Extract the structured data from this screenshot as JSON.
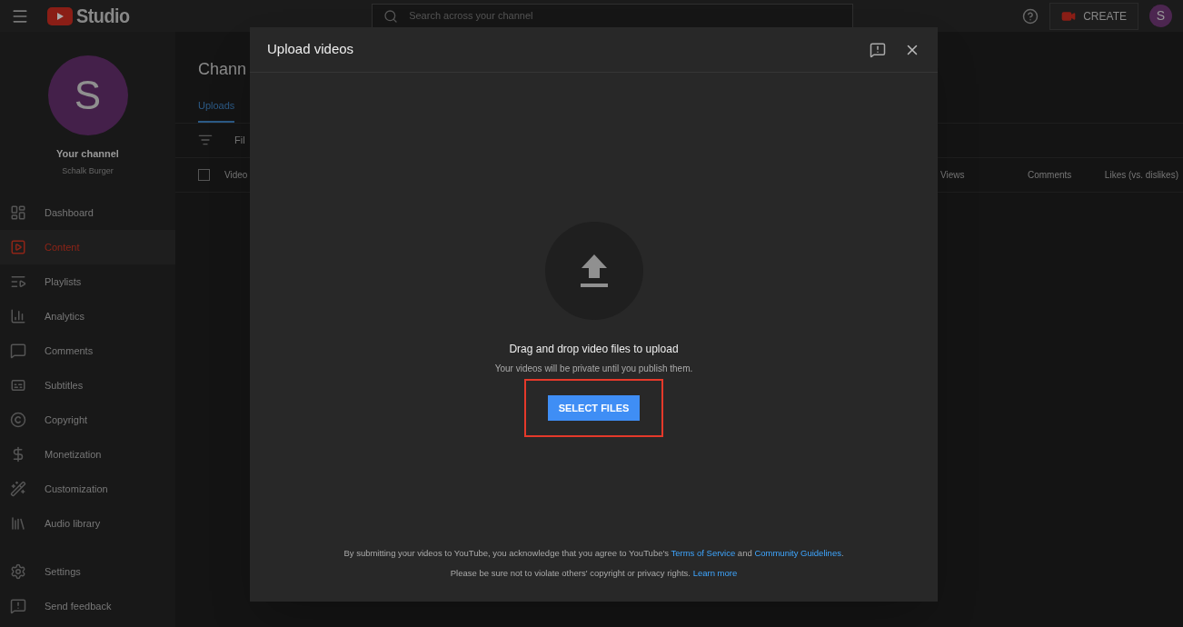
{
  "topbar": {
    "logo_text": "Studio",
    "search": {
      "placeholder": "Search across your channel"
    },
    "create_label": "CREATE",
    "avatar_letter": "S"
  },
  "sidebar": {
    "avatar_letter": "S",
    "channel_title": "Your channel",
    "channel_name": "Schalk Burger",
    "items": [
      {
        "label": "Dashboard",
        "selected": false
      },
      {
        "label": "Content",
        "selected": true
      },
      {
        "label": "Playlists",
        "selected": false
      },
      {
        "label": "Analytics",
        "selected": false
      },
      {
        "label": "Comments",
        "selected": false
      },
      {
        "label": "Subtitles",
        "selected": false
      },
      {
        "label": "Copyright",
        "selected": false
      },
      {
        "label": "Monetization",
        "selected": false
      },
      {
        "label": "Customization",
        "selected": false
      },
      {
        "label": "Audio library",
        "selected": false
      }
    ],
    "bottom_items": [
      {
        "label": "Settings"
      },
      {
        "label": "Send feedback"
      }
    ]
  },
  "main": {
    "title": "Chann",
    "tabs": [
      {
        "label": "Uploads",
        "selected": true
      }
    ],
    "filter_text": "Fil",
    "select_all_checked": false,
    "columns": [
      "Video",
      "Views",
      "Comments",
      "Likes (vs. dislikes)"
    ]
  },
  "dialog": {
    "title": "Upload videos",
    "prompt": "Drag and drop video files to upload",
    "subtext": "Your videos will be private until you publish them.",
    "button": "SELECT FILES",
    "highlighted": true,
    "footer_lines": [
      [
        {
          "kind": "text",
          "text": "By submitting your videos to YouTube, you acknowledge that you agree to YouTube's "
        },
        {
          "kind": "link",
          "text": "Terms of Service"
        },
        {
          "kind": "text",
          "text": " and "
        },
        {
          "kind": "link",
          "text": "Community Guidelines"
        },
        {
          "kind": "text",
          "text": "."
        }
      ],
      [
        {
          "kind": "text",
          "text": "Please be sure not to violate others' copyright or privacy rights. "
        },
        {
          "kind": "link",
          "text": "Learn more"
        }
      ]
    ]
  }
}
